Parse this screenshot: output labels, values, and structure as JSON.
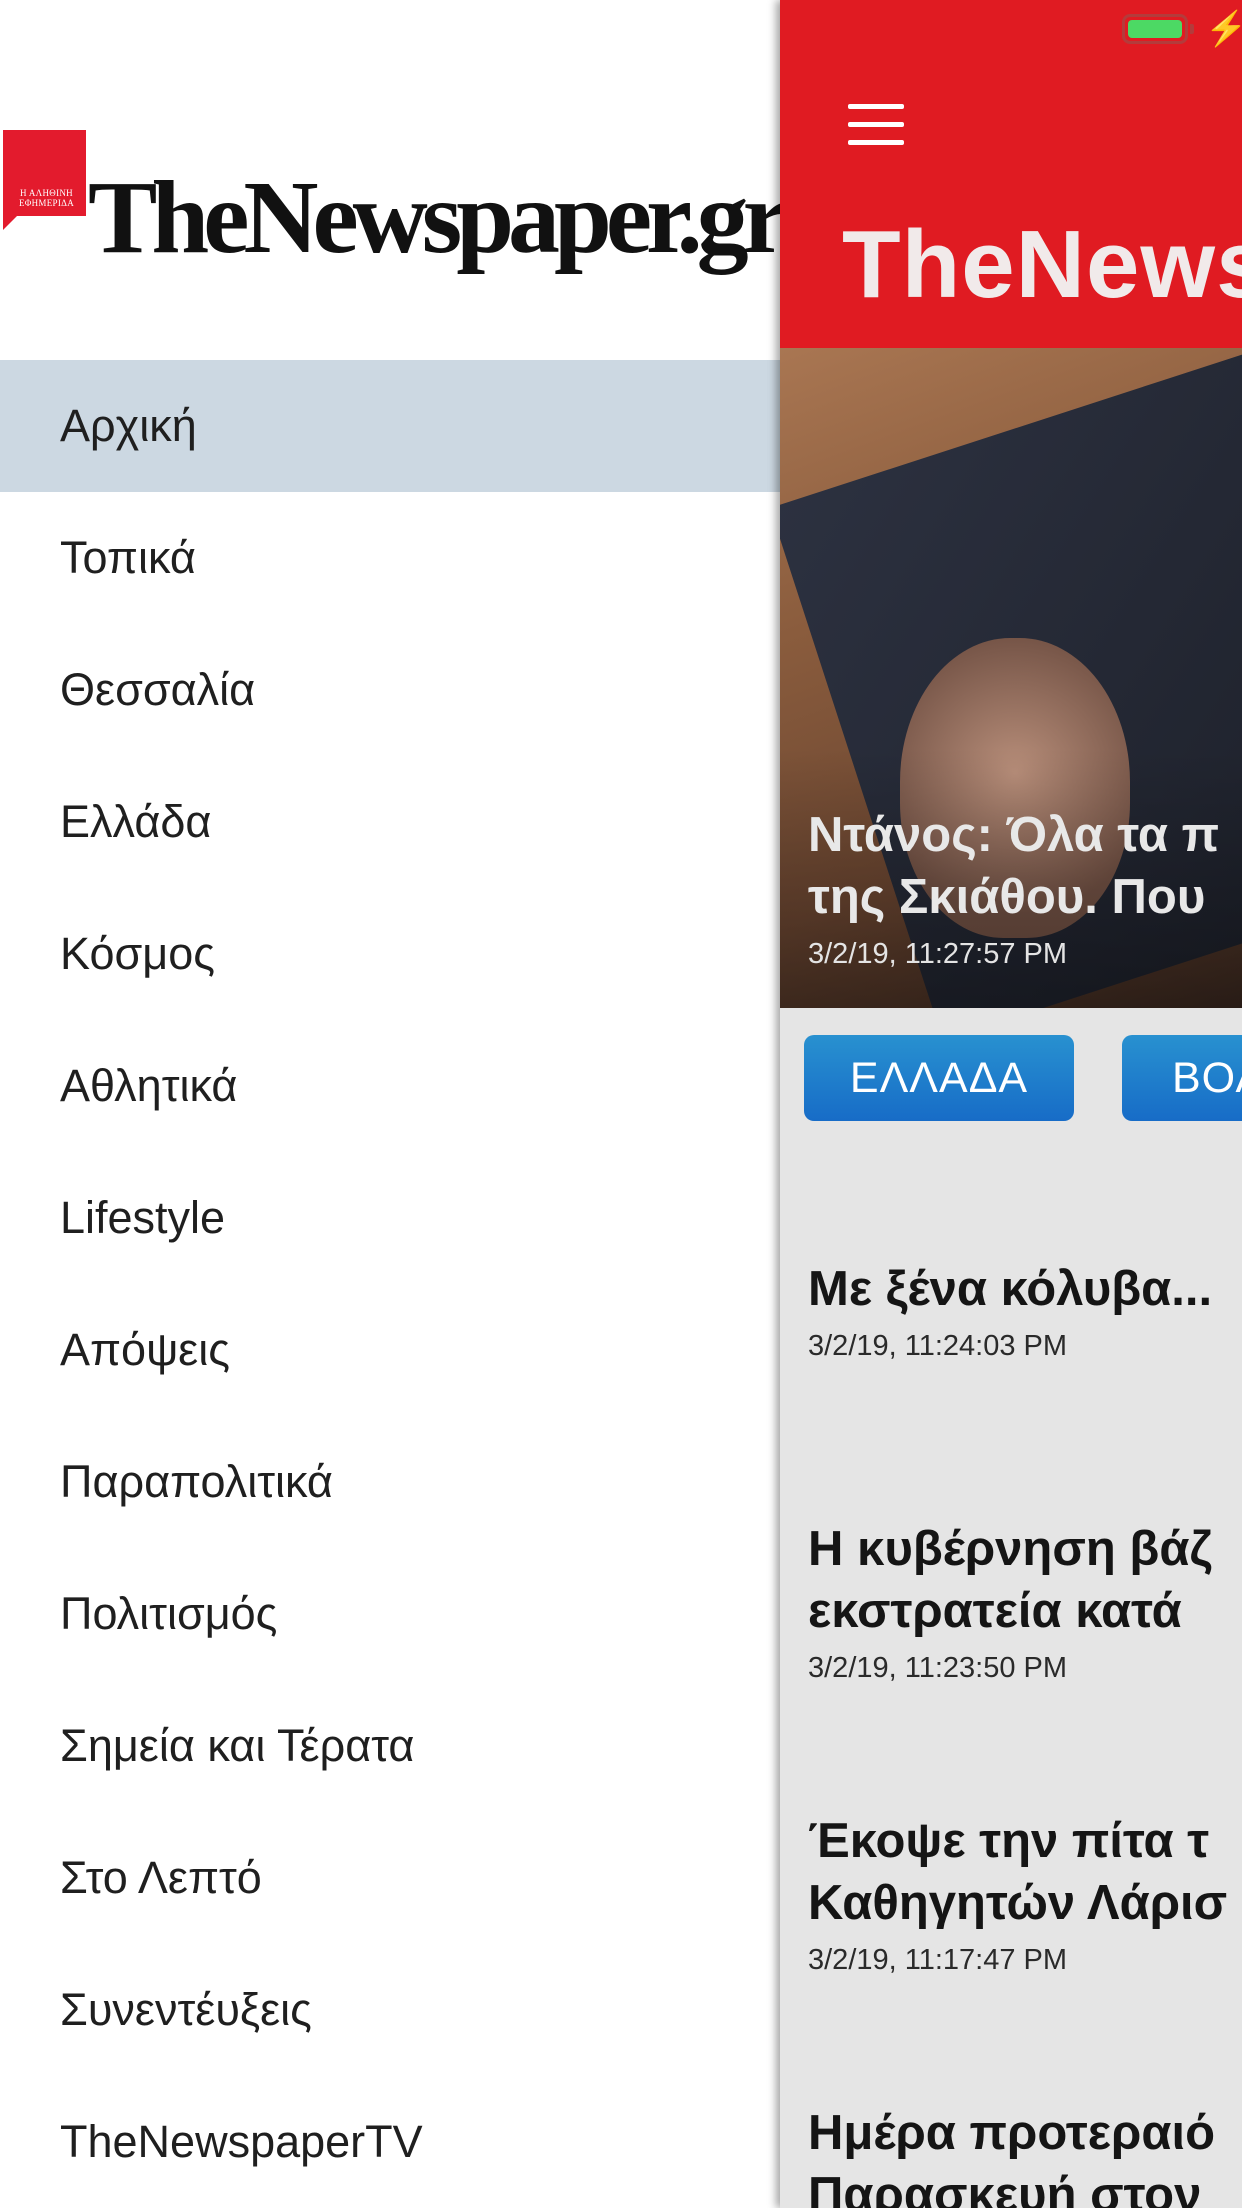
{
  "drawer": {
    "logo": {
      "wordmark": "TheNewspaper.gr",
      "badge_text": "Η ΑΛΗΘΙΝΗ ΕΦΗΜΕΡΙΔΑ",
      "accent": "#e31b2d"
    },
    "menu_items": [
      {
        "label": "Αρχική",
        "active": true
      },
      {
        "label": "Τοπικά"
      },
      {
        "label": "Θεσσαλία"
      },
      {
        "label": "Ελλάδα"
      },
      {
        "label": "Κόσμος"
      },
      {
        "label": "Αθλητικά"
      },
      {
        "label": "Lifestyle"
      },
      {
        "label": "Απόψεις"
      },
      {
        "label": "Παραπολιτικά"
      },
      {
        "label": "Πολιτισμός"
      },
      {
        "label": "Σημεία και Τέρατα"
      },
      {
        "label": "Στο Λεπτό"
      },
      {
        "label": "Συνεντέυξεις"
      },
      {
        "label": "TheNewspaperTV"
      }
    ],
    "active_color": "#ccd8e2"
  },
  "main": {
    "header": {
      "title": "TheNews",
      "menu_icon": "hamburger-icon",
      "background": "#e01b22"
    },
    "status_bar": {
      "battery_icon": "battery-icon",
      "charging_icon": "charging-bolt-icon",
      "charging_glyph": "⚡"
    },
    "hero": {
      "headline_line1": "Ντάνος: Όλα τα π",
      "headline_line2": "της Σκιάθου. Που",
      "date": "3/2/19, 11:27:57 PM"
    },
    "category_chips": [
      {
        "label": "ΕΛΛΑΔΑ"
      },
      {
        "label": "ΒΟΛ"
      }
    ],
    "articles": [
      {
        "title_lines": [
          "Με ξένα κόλυβα..."
        ],
        "date": "3/2/19, 11:24:03 PM"
      },
      {
        "title_lines": [
          "Η κυβέρνηση βάζ",
          "εκστρατεία κατά"
        ],
        "date": "3/2/19, 11:23:50 PM"
      },
      {
        "title_lines": [
          "Έκοψε την πίτα τ",
          "Καθηγητών Λάρισ"
        ],
        "date": "3/2/19, 11:17:47 PM"
      },
      {
        "title_lines": [
          "Ημέρα προτεραιό",
          "Παρασκευή στον"
        ],
        "date": ""
      }
    ]
  }
}
